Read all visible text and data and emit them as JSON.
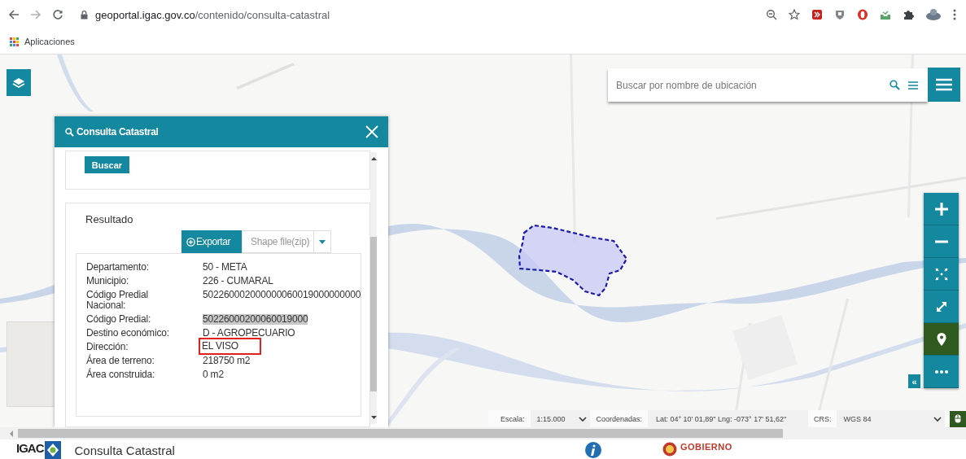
{
  "browser": {
    "url_domain": "geoportal.igac.gov.co",
    "url_path": "/contenido/consulta-catastral",
    "bookmarks": [
      {
        "label": "Aplicaciones"
      }
    ]
  },
  "map": {
    "search": {
      "placeholder": "Buscar por nombre de ubicación"
    },
    "controls": [
      {
        "kind": "zoom-in",
        "active": false
      },
      {
        "kind": "zoom-out",
        "active": false
      },
      {
        "kind": "extent",
        "active": false
      },
      {
        "kind": "fullscreen",
        "active": false
      },
      {
        "kind": "locate",
        "active": true
      },
      {
        "kind": "more",
        "active": false
      }
    ],
    "collapse_button": "«"
  },
  "dialog": {
    "title": "Consulta Catastral",
    "search_button": "Buscar",
    "result_title": "Resultado",
    "export_button": "Exportar",
    "export_format": "Shape file(zip)",
    "rows": [
      {
        "label": "Departamento:",
        "value": "50 - META",
        "text_selected": false,
        "marked": false
      },
      {
        "label": "Municipio:",
        "value": "226 - CUMARAL",
        "text_selected": false,
        "marked": false
      },
      {
        "label": "Código Predial Nacional:",
        "value": "502260002000000060019000000000",
        "text_selected": false,
        "marked": false
      },
      {
        "label": "Código Predial:",
        "value": "50226000200060019000",
        "text_selected": true,
        "marked": false
      },
      {
        "label": "Destino económico:",
        "value": "D - AGROPECUARIO",
        "text_selected": false,
        "marked": false
      },
      {
        "label": "Dirección:",
        "value": "EL VISO",
        "text_selected": false,
        "marked": true
      },
      {
        "label": "Área de terreno:",
        "value": "218750 m2",
        "text_selected": false,
        "marked": false
      },
      {
        "label": "Área construida:",
        "value": "0 m2",
        "text_selected": false,
        "marked": false
      }
    ]
  },
  "status_bar": {
    "scale_label": "Escala:",
    "scale": "1:15.000",
    "coords_label": "Coordenadas:",
    "coords": "Lat: 04° 10' 01,89\" Lng: -073° 17' 51,62\"",
    "crs_label": "CRS:",
    "crs": "WGS 84"
  },
  "footer": {
    "logo": "IGAC",
    "title": "Consulta Catastral",
    "gov_logo": "GOBIERNO"
  }
}
